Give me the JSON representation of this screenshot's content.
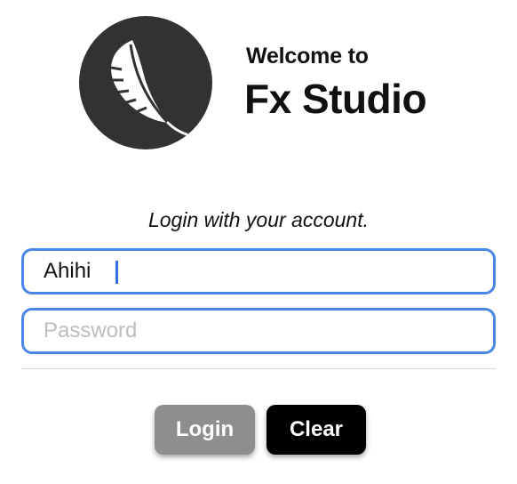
{
  "header": {
    "logo_icon": "feather-icon",
    "welcome_label": "Welcome to",
    "app_name": "Fx Studio"
  },
  "form": {
    "subtitle": "Login with your account.",
    "username": {
      "value": "Ahihi",
      "placeholder": ""
    },
    "password": {
      "value": "",
      "placeholder": "Password"
    }
  },
  "actions": {
    "login_label": "Login",
    "clear_label": "Clear"
  },
  "colors": {
    "field_border": "#4a86e8",
    "login_button": "#8e8e8e",
    "clear_button": "#000000",
    "logo_bg": "#323232"
  }
}
